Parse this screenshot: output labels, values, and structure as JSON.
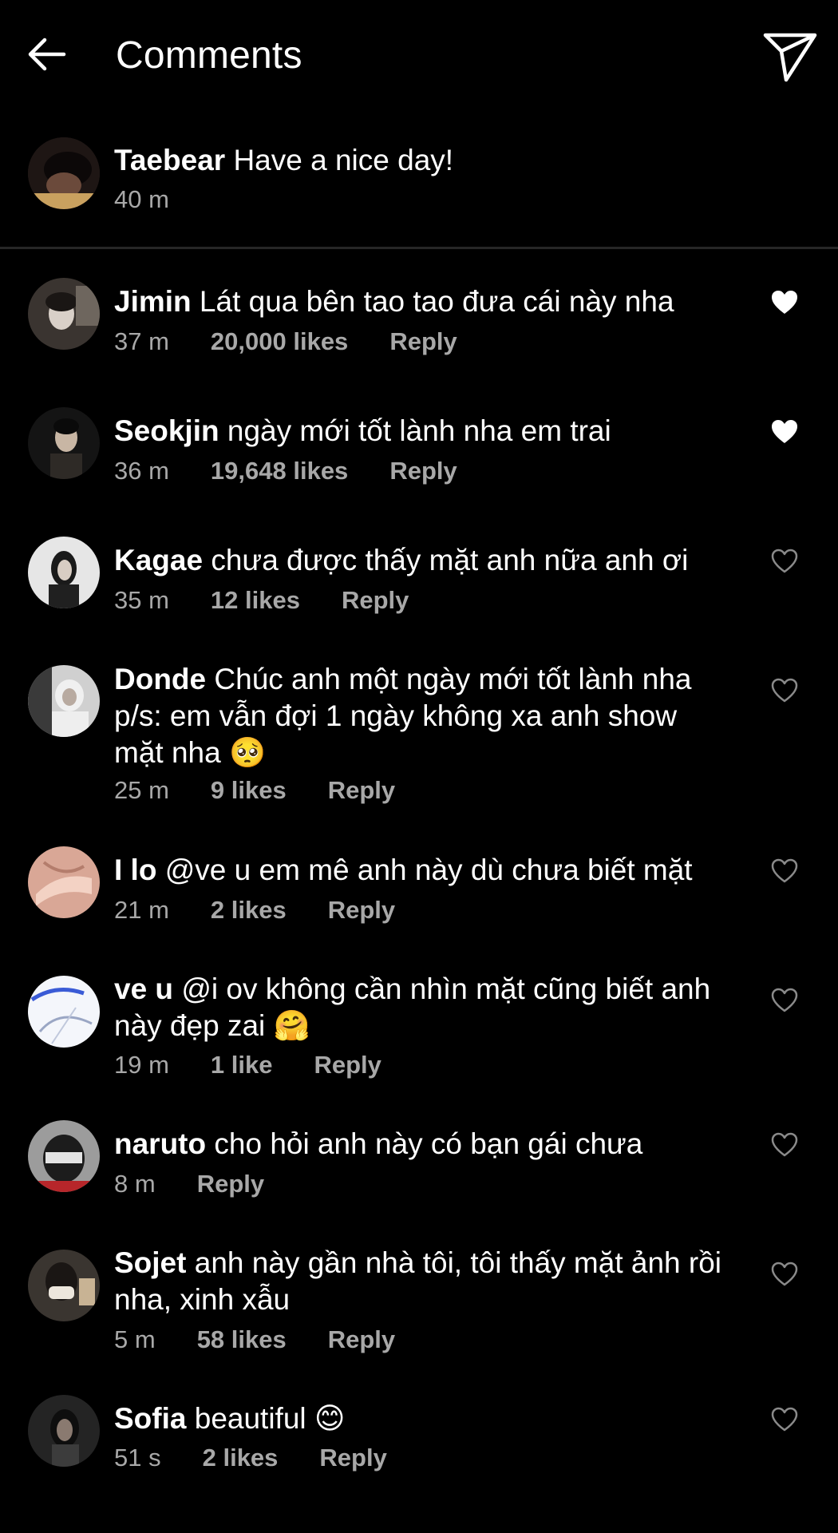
{
  "header": {
    "title": "Comments",
    "back_icon": "arrow-left-icon",
    "share_icon": "paper-plane-icon"
  },
  "caption": {
    "username": "Taebear",
    "text": "Have a nice day!",
    "time": "40 m"
  },
  "comments": [
    {
      "username": "Jimin",
      "text": "Lát qua bên tao tao đưa cái này nha",
      "time": "37 m",
      "likes": "20,000 likes",
      "reply": "Reply",
      "liked": true
    },
    {
      "username": "Seokjin",
      "text": "ngày mới tốt lành nha em trai",
      "time": "36 m",
      "likes": "19,648 likes",
      "reply": "Reply",
      "liked": true
    },
    {
      "username": "Kagae",
      "text": "chưa được thấy mặt anh nữa anh ơi",
      "time": "35 m",
      "likes": "12 likes",
      "reply": "Reply",
      "liked": false
    },
    {
      "username": "Donde",
      "text": "Chúc anh một ngày mới tốt lành nha p/s: em vẫn đợi 1 ngày không xa anh show mặt nha 🥺",
      "time": "25 m",
      "likes": "9 likes",
      "reply": "Reply",
      "liked": false
    },
    {
      "username": "I lo",
      "text": "@ve u em mê anh này dù chưa biết mặt",
      "time": "21 m",
      "likes": "2 likes",
      "reply": "Reply",
      "liked": false
    },
    {
      "username": "ve u",
      "text": "@i ov không cần nhìn mặt cũng biết anh này đẹp zai 🤗",
      "time": "19 m",
      "likes": "1 like",
      "reply": "Reply",
      "liked": false
    },
    {
      "username": "naruto",
      "text": "cho hỏi anh này có bạn gái chưa",
      "time": "8 m",
      "likes": "",
      "reply": "Reply",
      "liked": false
    },
    {
      "username": "Sojet",
      "text": "anh này gần nhà tôi, tôi thấy mặt ảnh rồi nha, xinh xẫu",
      "time": "5 m",
      "likes": "58 likes",
      "reply": "Reply",
      "liked": false
    },
    {
      "username": "Sofia",
      "text": "beautiful 😊",
      "time": "51 s",
      "likes": "2 likes",
      "reply": "Reply",
      "liked": false
    }
  ],
  "colors": {
    "background": "#000000",
    "text": "#ffffff",
    "meta": "#a8a8a8",
    "divider": "#262626"
  }
}
